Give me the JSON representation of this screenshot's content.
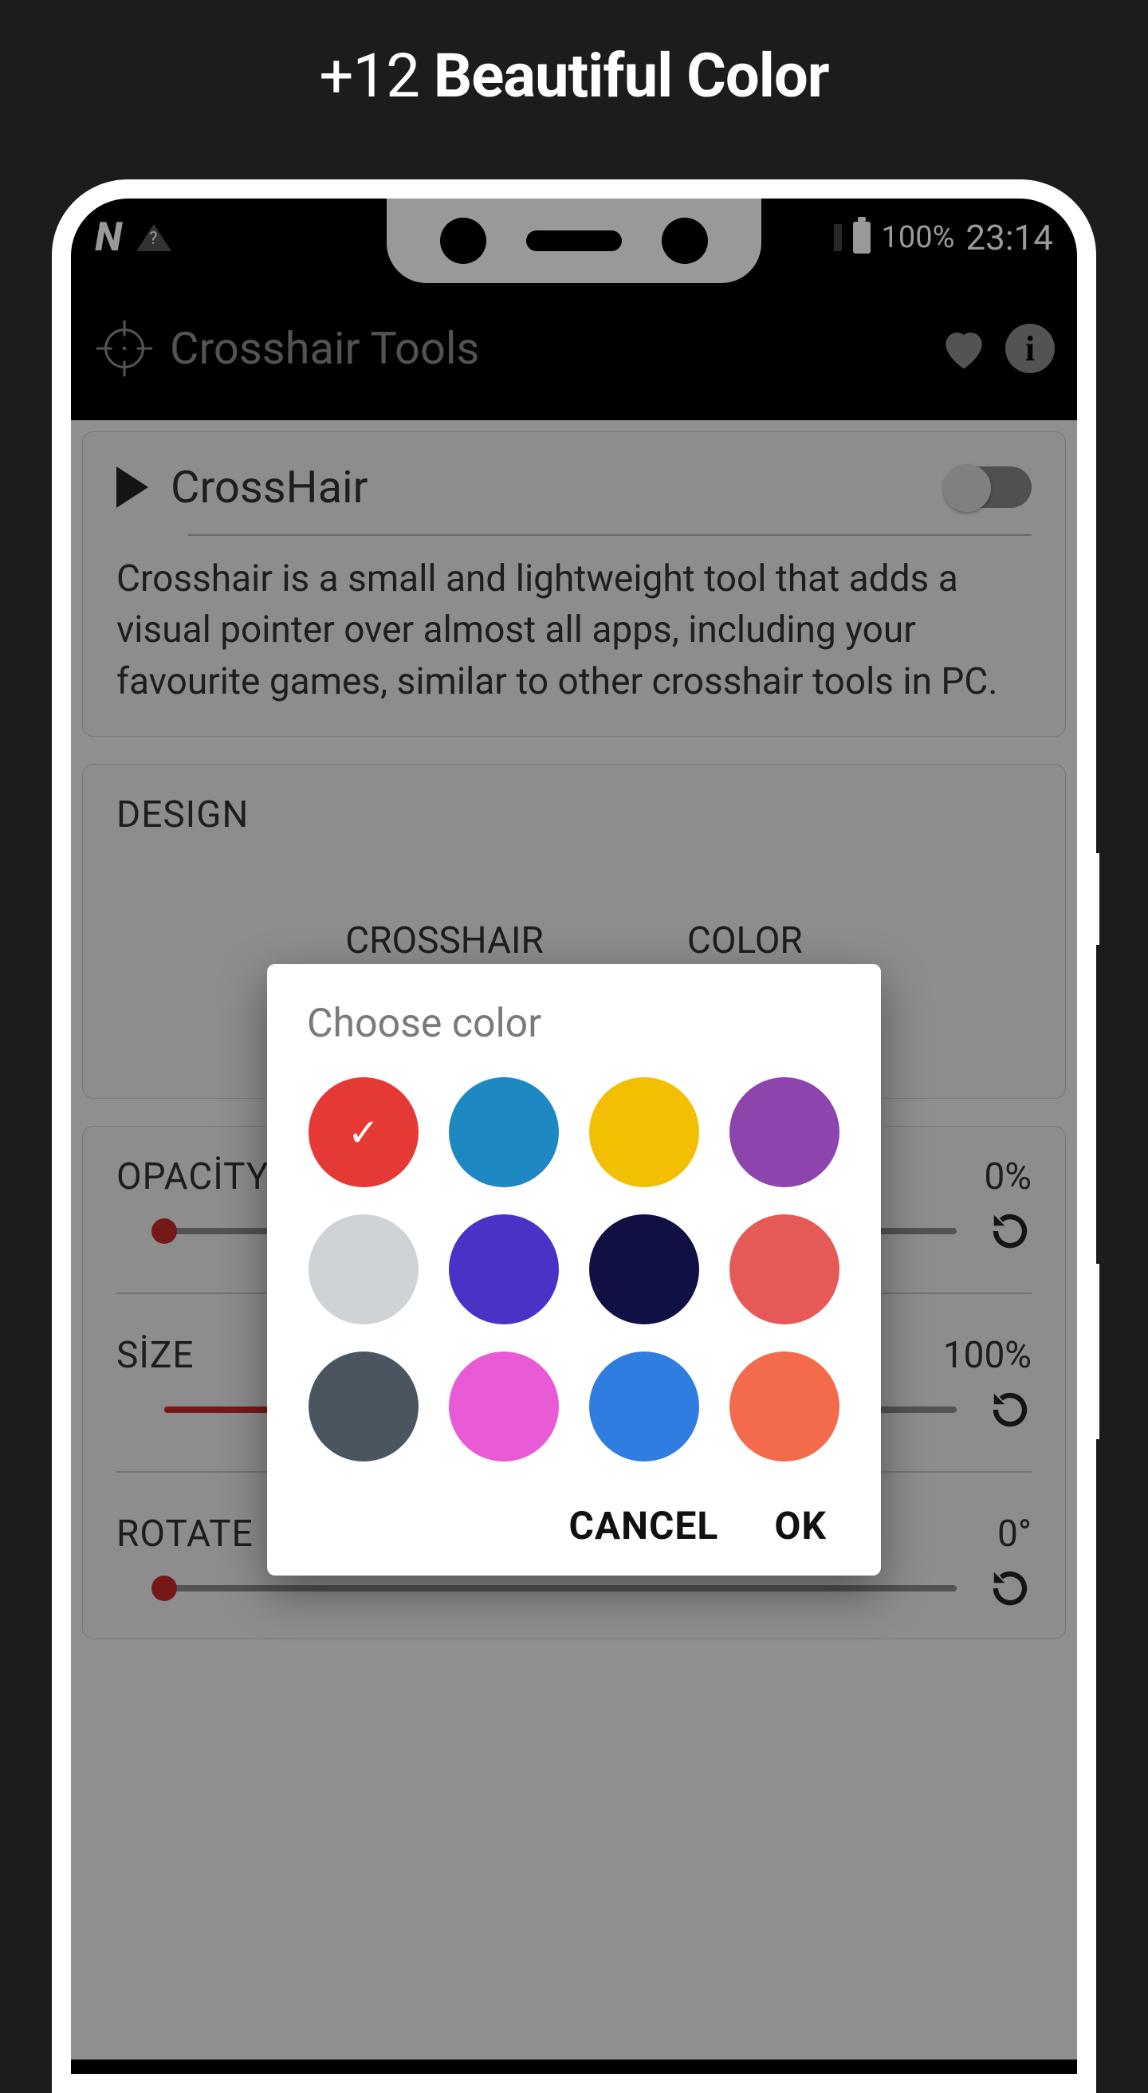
{
  "promo": {
    "prefix": "+12 ",
    "bold": "Beautiful Color"
  },
  "status": {
    "battery_pct": "100%",
    "time": "23:14"
  },
  "header": {
    "title": "Crosshair Tools"
  },
  "main_card": {
    "title": "CrossHair",
    "description": "Crosshair is a small and lightweight tool that adds a visual pointer over almost all apps, including your favourite games, similar to other crosshair tools in PC.",
    "toggle_on": false
  },
  "design": {
    "label": "DESIGN",
    "option_left": "CROSSHAIR",
    "option_right": "COLOR"
  },
  "sliders": {
    "opacity": {
      "label": "OPACİTY",
      "value": "0%",
      "pct": 0
    },
    "size": {
      "label": "SİZE",
      "value": "100%",
      "pct": 36
    },
    "rotate": {
      "label": "ROTATE",
      "value": "0°",
      "pct": 0
    }
  },
  "dialog": {
    "title": "Choose color",
    "cancel": "CANCEL",
    "ok": "OK",
    "selected_index": 0,
    "colors": [
      "#e53935",
      "#1e88c3",
      "#f2c000",
      "#8e44ad",
      "#cfd3d6",
      "#4a32c7",
      "#101045",
      "#e55a56",
      "#4a5560",
      "#e85ad6",
      "#2f7de0",
      "#f36b4b"
    ]
  }
}
